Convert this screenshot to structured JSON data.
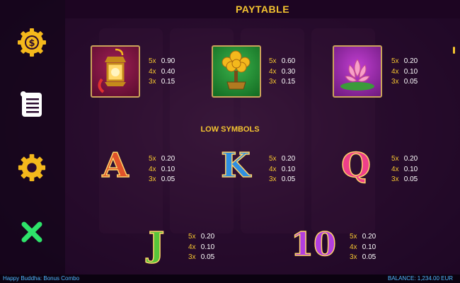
{
  "header": {
    "title": "PAYTABLE"
  },
  "sidebar": {
    "buttons": [
      {
        "icon": "coin-dollar-icon"
      },
      {
        "icon": "paytable-scroll-icon"
      },
      {
        "icon": "settings-gear-icon"
      },
      {
        "icon": "close-x-icon"
      }
    ]
  },
  "high_symbols": [
    {
      "icon": "lantern-icon",
      "pays": [
        {
          "mult": "5x",
          "val": "0.90"
        },
        {
          "mult": "4x",
          "val": "0.40"
        },
        {
          "mult": "3x",
          "val": "0.15"
        }
      ]
    },
    {
      "icon": "money-tree-icon",
      "pays": [
        {
          "mult": "5x",
          "val": "0.60"
        },
        {
          "mult": "4x",
          "val": "0.30"
        },
        {
          "mult": "3x",
          "val": "0.15"
        }
      ]
    },
    {
      "icon": "lotus-icon",
      "pays": [
        {
          "mult": "5x",
          "val": "0.20"
        },
        {
          "mult": "4x",
          "val": "0.10"
        },
        {
          "mult": "3x",
          "val": "0.05"
        }
      ]
    }
  ],
  "low_title": "LOW SYMBOLS",
  "low_symbols": [
    {
      "symbol": "A",
      "color": "#e0532a",
      "pays": [
        {
          "mult": "5x",
          "val": "0.20"
        },
        {
          "mult": "4x",
          "val": "0.10"
        },
        {
          "mult": "3x",
          "val": "0.05"
        }
      ]
    },
    {
      "symbol": "K",
      "color": "#2f8fe0",
      "pays": [
        {
          "mult": "5x",
          "val": "0.20"
        },
        {
          "mult": "4x",
          "val": "0.10"
        },
        {
          "mult": "3x",
          "val": "0.05"
        }
      ]
    },
    {
      "symbol": "Q",
      "color": "#ee3f8a",
      "pays": [
        {
          "mult": "5x",
          "val": "0.20"
        },
        {
          "mult": "4x",
          "val": "0.10"
        },
        {
          "mult": "3x",
          "val": "0.05"
        }
      ]
    },
    {
      "symbol": "J",
      "color": "#57c43a",
      "pays": [
        {
          "mult": "5x",
          "val": "0.20"
        },
        {
          "mult": "4x",
          "val": "0.10"
        },
        {
          "mult": "3x",
          "val": "0.05"
        }
      ]
    },
    {
      "symbol": "10",
      "color": "#b23ee0",
      "pays": [
        {
          "mult": "5x",
          "val": "0.20"
        },
        {
          "mult": "4x",
          "val": "0.10"
        },
        {
          "mult": "3x",
          "val": "0.05"
        }
      ]
    }
  ],
  "footer": {
    "game_name": "Happy Buddha: Bonus Combo",
    "balance": "BALANCE: 1,234.00 EUR"
  },
  "colors": {
    "gold": "#f4c430",
    "footer_text": "#4fb8ff"
  }
}
